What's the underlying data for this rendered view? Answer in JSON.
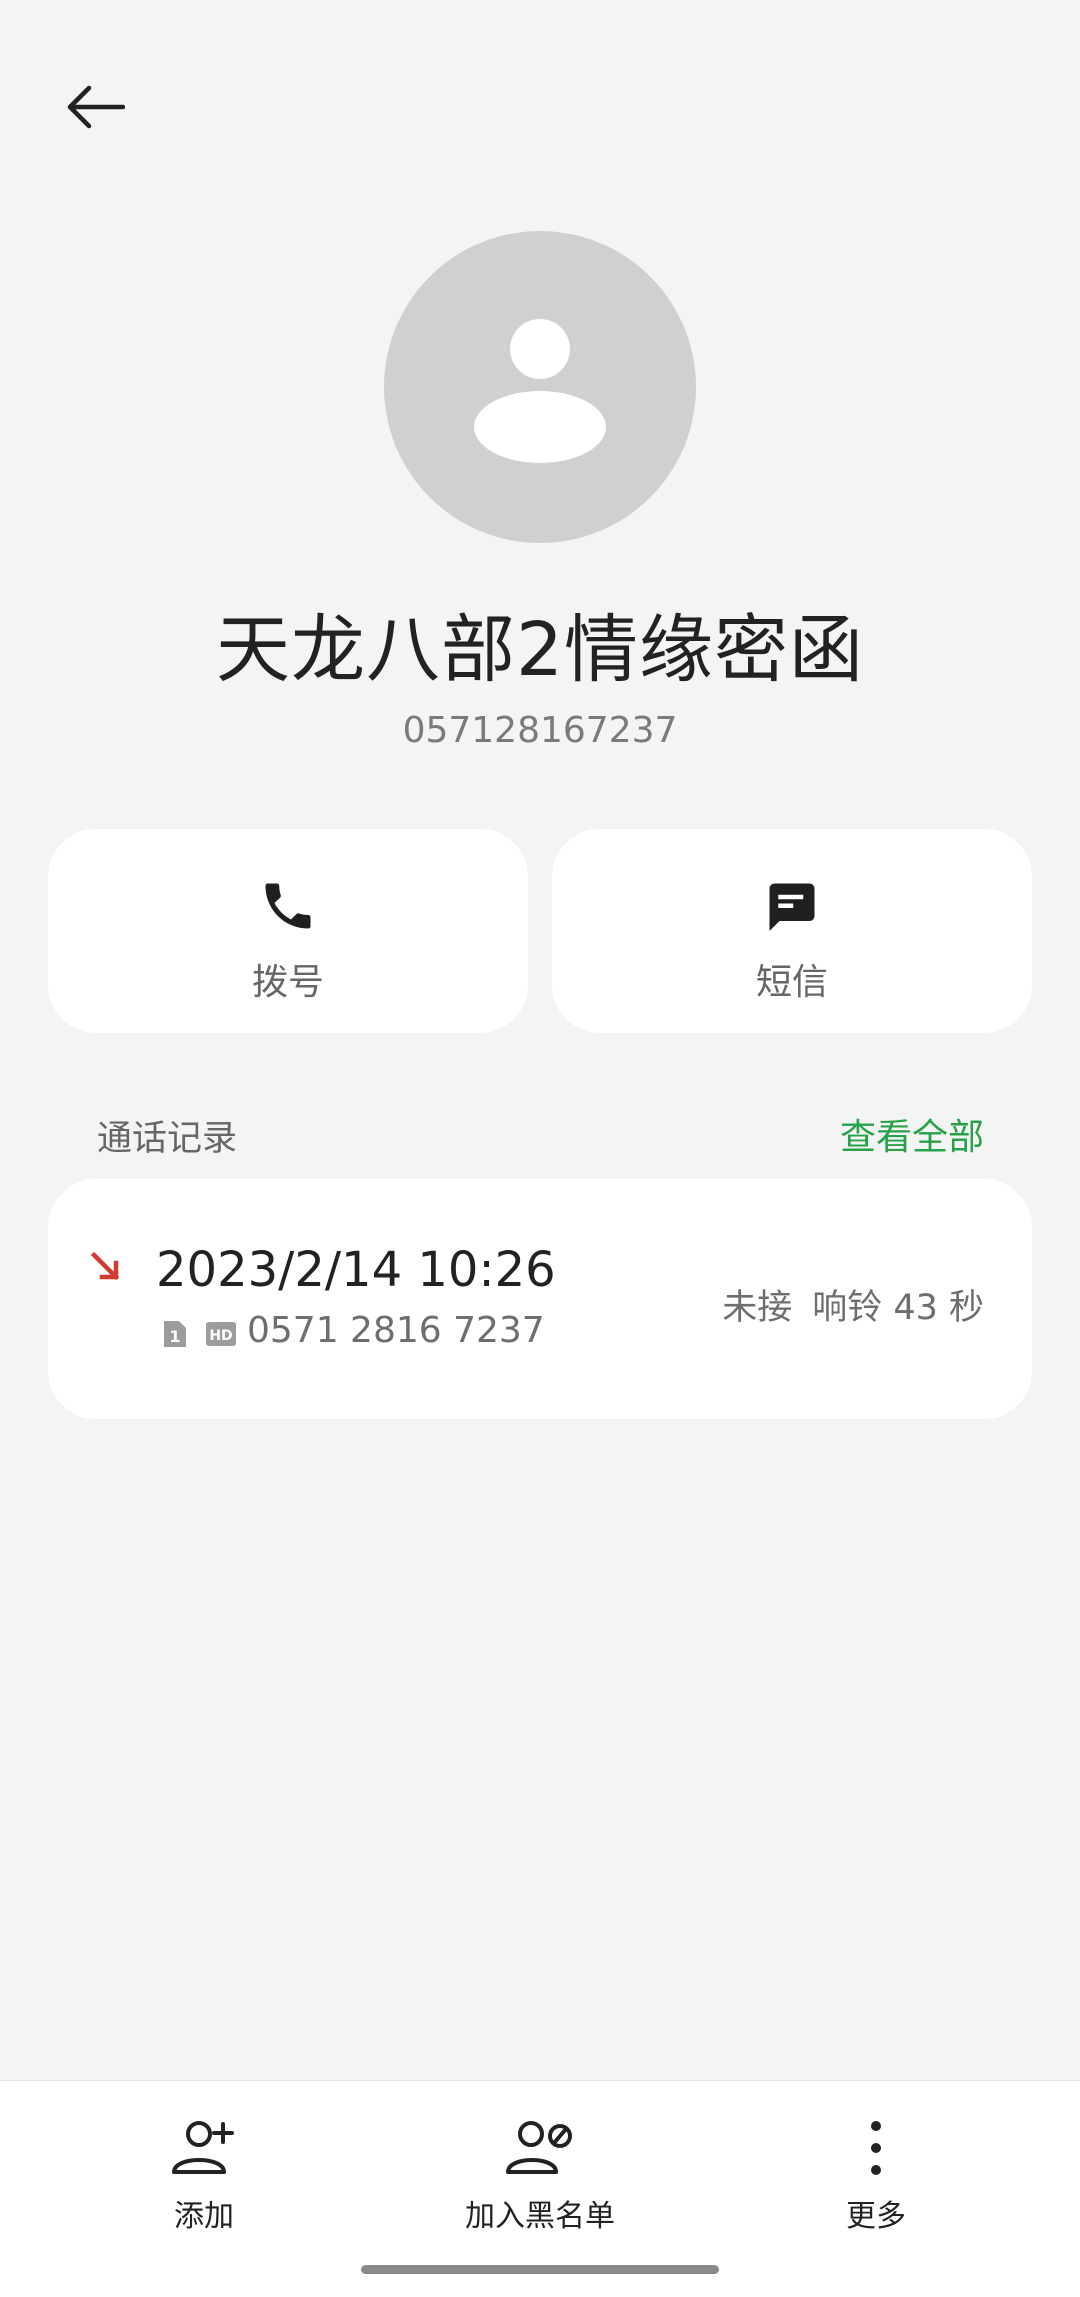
{
  "header": {
    "back_icon": "arrow-left-icon"
  },
  "contact": {
    "name": "天龙八部2情缘密函",
    "number": "057128167237",
    "avatar_icon": "person-placeholder-icon"
  },
  "actions": [
    {
      "label": "拨号",
      "icon": "phone-icon"
    },
    {
      "label": "短信",
      "icon": "message-icon"
    }
  ],
  "call_log": {
    "title": "通话记录",
    "view_all": "查看全部",
    "entries": [
      {
        "datetime": "2023/2/14 10:26",
        "number": "0571 2816 7237",
        "sim_badge": "1",
        "hd_badge": "HD",
        "result": "未接",
        "detail": "响铃 43 秒",
        "icon": "missed-call-icon"
      }
    ]
  },
  "bottom_bar": [
    {
      "label": "添加",
      "icon": "add-contact-icon"
    },
    {
      "label": "加入黑名单",
      "icon": "block-contact-icon"
    },
    {
      "label": "更多",
      "icon": "more-vertical-icon"
    }
  ],
  "colors": {
    "accent": "#27a249",
    "missed": "#d23a32",
    "background": "#f4f4f4",
    "avatar": "#d0d0d0"
  }
}
